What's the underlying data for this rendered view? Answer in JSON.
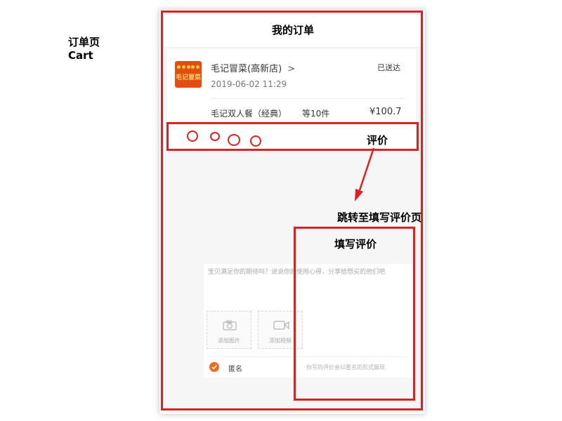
{
  "annotations": {
    "page_name": "订单页",
    "page_name_en": "Cart",
    "rate_label": "评价",
    "jump_label": "跳转至填写评价页",
    "fill_review_label": "填写评价"
  },
  "orders_page": {
    "title": "我的订单",
    "order": {
      "logo_text": "毛记冒菜",
      "store_name": "毛记冒菜(高新店)",
      "chevron": ">",
      "status": "已送达",
      "datetime": "2019-06-02 11:29",
      "item": "毛记双人餐（经典）",
      "quantity": "等10件",
      "price": "¥100.7"
    },
    "rating_stars": 4
  },
  "review_form": {
    "placeholder": "宝贝满足你的期待吗？说说你的使用心得，分享给想买的他们吧",
    "add_image": "添加图片",
    "add_video": "添加视频",
    "anonymous_label": "匿名",
    "anonymous_hint": "你写的评价会以匿名的形式展现"
  },
  "colors": {
    "annotation_red": "#e02020",
    "accent_orange": "#f06a1c",
    "logo_bg": "#e34d10"
  }
}
